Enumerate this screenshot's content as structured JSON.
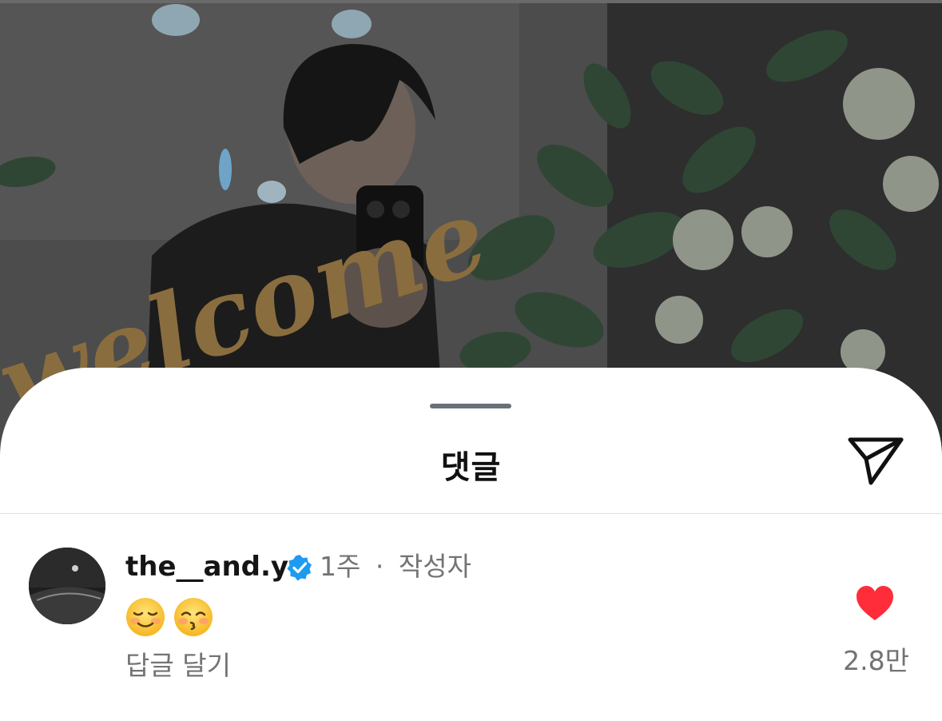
{
  "photo": {
    "description_icon": "background-photo",
    "sign_text": "welcome"
  },
  "sheet": {
    "title": "댓글",
    "share_icon": "paper-plane-icon"
  },
  "comment": {
    "username": "the__and.y",
    "verified_icon": "verified-badge-icon",
    "time": "1주",
    "separator": "·",
    "author_tag": "작성자",
    "emojis": [
      "relieved-smile-emoji",
      "kissing-smile-emoji"
    ],
    "reply_label": "답글 달기",
    "like_icon": "heart-filled-icon",
    "like_color": "#ff2d3a",
    "like_count": "2.8만"
  },
  "colors": {
    "verified": "#1d9bf0",
    "secondary_text": "#737373",
    "sheet_bg": "#ffffff"
  }
}
